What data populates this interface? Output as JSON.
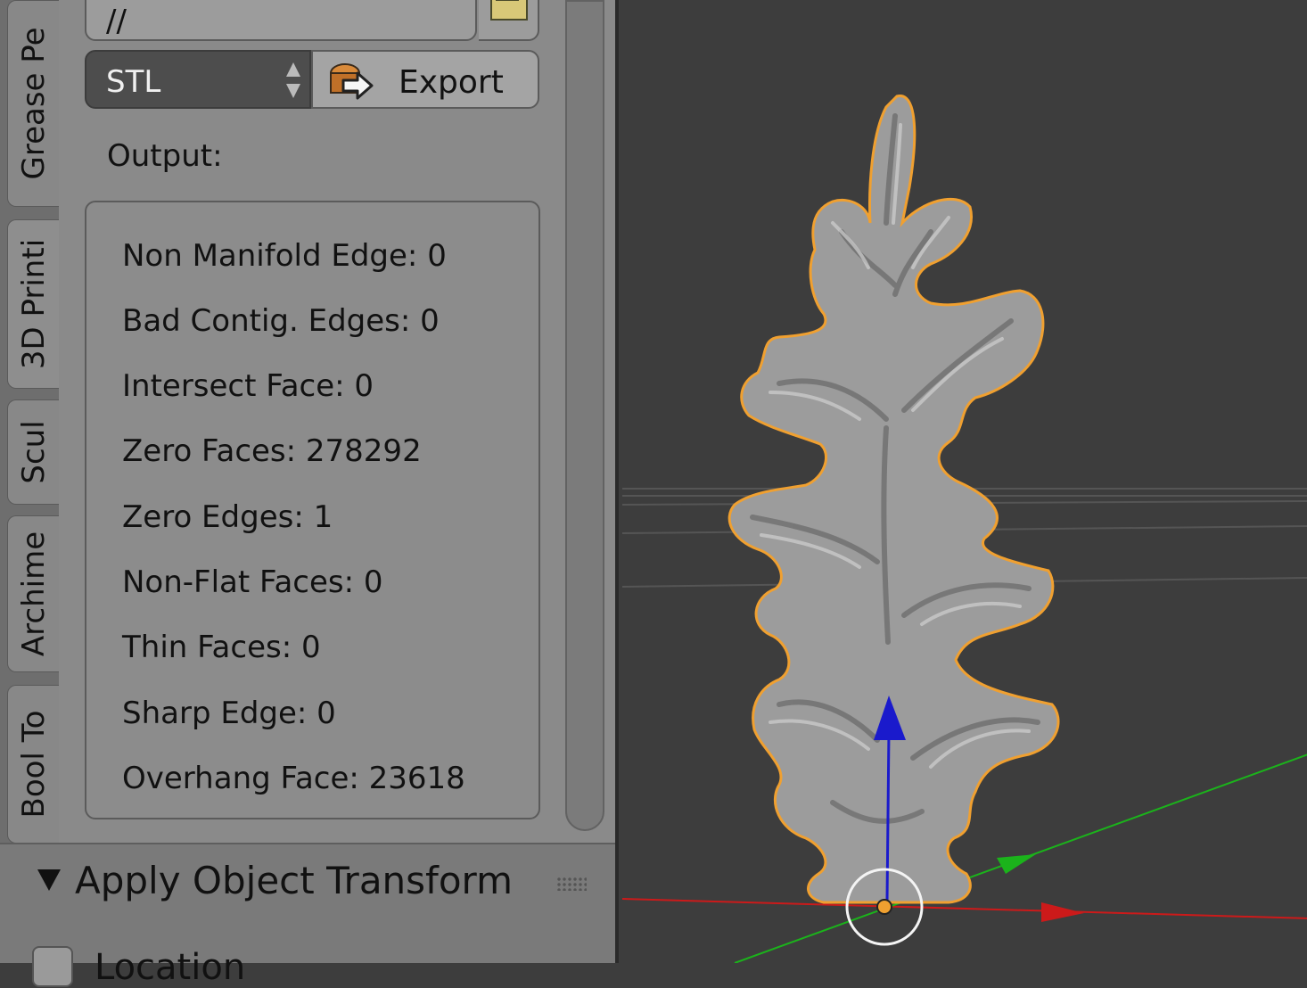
{
  "tabs": [
    {
      "label": "Grease Pe"
    },
    {
      "label": "3D Printi"
    },
    {
      "label": "Scul"
    },
    {
      "label": "Archime"
    },
    {
      "label": "Bool To"
    }
  ],
  "export": {
    "path_value": "//",
    "format_value": "STL",
    "button_label": "Export"
  },
  "output": {
    "label": "Output:",
    "lines": [
      "Non Manifold Edge: 0",
      "Bad Contig. Edges: 0",
      "Intersect Face: 0",
      "Zero Faces: 278292",
      "Zero Edges: 1",
      "Non-Flat Faces: 0",
      "Thin Faces: 0",
      "Sharp Edge: 0",
      "Overhang Face: 23618"
    ]
  },
  "apply_transform": {
    "title": "Apply Object Transform",
    "location_label": "Location"
  },
  "colors": {
    "viewport_bg": "#3d3d3d",
    "selection_outline": "#f0a030",
    "axis_x": "#cc1a1a",
    "axis_y": "#1bb31b",
    "axis_z": "#1a1acc"
  }
}
